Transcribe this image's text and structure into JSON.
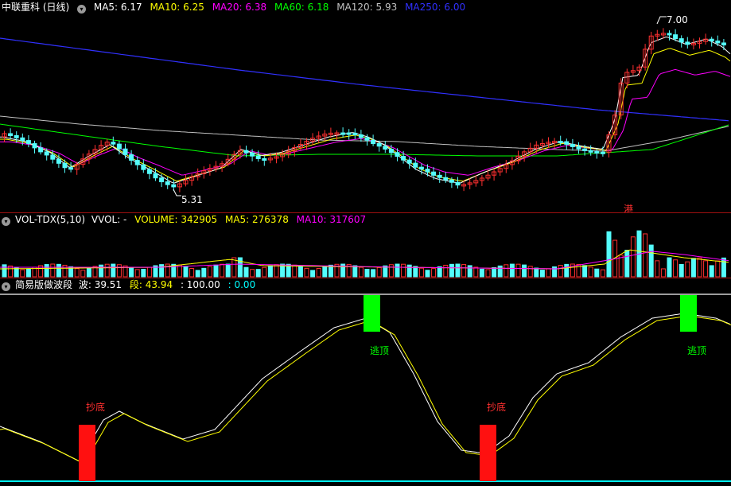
{
  "price_panel": {
    "title": "中联重科 (日线)",
    "ma": [
      {
        "label": "MA5: 6.17",
        "color": "#ffffff"
      },
      {
        "label": "MA10: 6.25",
        "color": "#ffff00"
      },
      {
        "label": "MA20: 6.38",
        "color": "#ff00ff"
      },
      {
        "label": "MA60: 6.18",
        "color": "#00ff00"
      },
      {
        "label": "MA120: 5.93",
        "color": "#c0c0c0"
      },
      {
        "label": "MA250: 6.00",
        "color": "#3030ff"
      }
    ],
    "high_label": "7.00",
    "low_label": "5.31",
    "hk_label": "港"
  },
  "volume_panel": {
    "title": "VOL-TDX(5,10)",
    "items": [
      {
        "label": "VVOL: -",
        "color": "#ffffff"
      },
      {
        "label": "VOLUME: 342905",
        "color": "#ffff00"
      },
      {
        "label": "MA5: 276378",
        "color": "#ffff00"
      },
      {
        "label": "MA10: 317607",
        "color": "#ff00ff"
      }
    ]
  },
  "wave_panel": {
    "title": "简易版做波段",
    "items": [
      {
        "label": "波: 39.51",
        "color": "#ffffff"
      },
      {
        "label": "段: 43.94",
        "color": "#ffff00"
      },
      {
        "label": ": 100.00",
        "color": "#ffffff"
      },
      {
        "label": ": 0.00",
        "color": "#00ffff"
      }
    ],
    "signals": {
      "bottom": "抄底",
      "top": "逃顶"
    }
  },
  "colors": {
    "up": "#ff3030",
    "down": "#54fcfc",
    "separator": "#a01010"
  },
  "chart_data": [
    {
      "type": "line",
      "title": "中联重科 (日线)",
      "series": [
        {
          "name": "MA5",
          "values": [
            6.17
          ]
        },
        {
          "name": "MA10",
          "values": [
            6.25
          ]
        },
        {
          "name": "MA20",
          "values": [
            6.38
          ]
        },
        {
          "name": "MA60",
          "values": [
            6.18
          ]
        },
        {
          "name": "MA120",
          "values": [
            5.93
          ]
        },
        {
          "name": "MA250",
          "values": [
            6.0
          ]
        }
      ],
      "annotations": [
        "7.00",
        "5.31"
      ],
      "ylim": [
        5.2,
        7.1
      ]
    },
    {
      "type": "bar",
      "title": "VOL-TDX(5,10)",
      "series": [
        {
          "name": "VOLUME",
          "values": [
            342905
          ]
        },
        {
          "name": "MA5",
          "values": [
            276378
          ]
        },
        {
          "name": "MA10",
          "values": [
            317607
          ]
        }
      ]
    },
    {
      "type": "line",
      "title": "简易版做波段",
      "series": [
        {
          "name": "波",
          "values": [
            39.51
          ]
        },
        {
          "name": "段",
          "values": [
            43.94
          ]
        }
      ],
      "ylim": [
        0,
        100
      ]
    }
  ]
}
